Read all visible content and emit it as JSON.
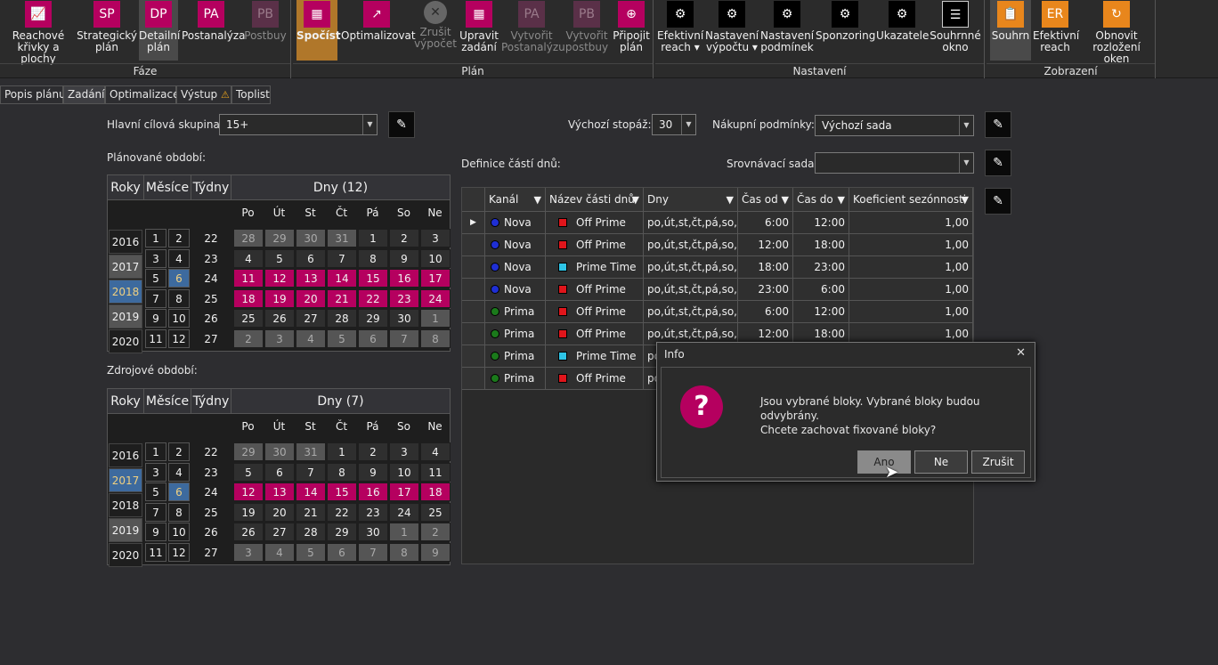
{
  "ribbon": {
    "groups": [
      {
        "label": "Fáze",
        "buttons": [
          {
            "icon": "chart-icon",
            "label": "Reachové\nkřivky a plochy"
          },
          {
            "abbr": "SP",
            "label": "Strategický\nplán"
          },
          {
            "abbr": "DP",
            "label": "Detailní\nplán"
          },
          {
            "abbr": "PA",
            "label": "Postanalýza"
          },
          {
            "abbr": "PB",
            "label": "Postbuy"
          }
        ]
      },
      {
        "label": "Plán",
        "buttons": [
          {
            "icon": "grid-icon",
            "label": "Spočíst"
          },
          {
            "icon": "optimize-icon",
            "label": "Optimalizovat"
          },
          {
            "icon": "cancel-icon",
            "label": "Zrušit\nvýpočet"
          },
          {
            "icon": "grid-edit-icon",
            "label": "Upravit\nzadání"
          },
          {
            "abbr": "PA",
            "label": "Vytvořit\nPostanalýzu"
          },
          {
            "abbr": "PB",
            "label": "Vytvořit\npostbuy"
          },
          {
            "icon": "attach-plan-icon",
            "label": "Připojit\nplán"
          }
        ]
      },
      {
        "label": "Nastavení",
        "buttons": [
          {
            "icon": "gear-icon",
            "label": "Efektivní\nreach ▾"
          },
          {
            "icon": "gear-icon",
            "label": "Nastavení\nvýpočtu ▾"
          },
          {
            "icon": "gear-icon",
            "label": "Nastavení\npodmínek"
          },
          {
            "icon": "gear-icon",
            "label": "Sponzoring"
          },
          {
            "icon": "gear-icon",
            "label": "Ukazatele"
          },
          {
            "icon": "summary-window-icon",
            "label": "Souhrnné\nokno"
          }
        ]
      },
      {
        "label": "Zobrazení",
        "buttons": [
          {
            "icon": "clipboard-icon",
            "label": "Souhrn"
          },
          {
            "abbr": "ER",
            "label": "Efektivní\nreach"
          },
          {
            "icon": "refresh-icon",
            "label": "Obnovit\nrozložení oken"
          }
        ]
      }
    ]
  },
  "tabs": [
    "Popis plánu",
    "Zadání",
    "Optimalizace",
    "Výstup",
    "Toplist"
  ],
  "form": {
    "target_group_label": "Hlavní cílová skupina:",
    "target_group_value": "15+",
    "footage_label": "Výchozí stopáž:",
    "footage_value": "30",
    "purchase_label": "Nákupní podmínky:",
    "purchase_value": "Výchozí sada",
    "planned_period_label": "Plánované období:",
    "daypart_def_label": "Definice částí dnů:",
    "compare_label": "Srovnávací sada:",
    "compare_value": "",
    "source_period_label": "Zdrojové období:"
  },
  "calendar_headers": {
    "years": "Roky",
    "months": "Měsíce",
    "weeks": "Týdny"
  },
  "weekdays": [
    "Po",
    "Út",
    "St",
    "Čt",
    "Pá",
    "So",
    "Ne"
  ],
  "planned": {
    "days_title": "Dny (12)",
    "years": [
      "2016",
      "2017",
      "2018",
      "2019",
      "2020"
    ],
    "months": [
      [
        "1",
        "2"
      ],
      [
        "3",
        "4"
      ],
      [
        "5",
        "6"
      ],
      [
        "7",
        "8"
      ],
      [
        "9",
        "10"
      ],
      [
        "11",
        "12"
      ]
    ],
    "weeks": [
      "22",
      "23",
      "24",
      "25",
      "26",
      "27"
    ],
    "days": [
      [
        "28",
        "29",
        "30",
        "31",
        "1",
        "2",
        "3"
      ],
      [
        "4",
        "5",
        "6",
        "7",
        "8",
        "9",
        "10"
      ],
      [
        "11",
        "12",
        "13",
        "14",
        "15",
        "16",
        "17"
      ],
      [
        "18",
        "19",
        "20",
        "21",
        "22",
        "23",
        "24"
      ],
      [
        "25",
        "26",
        "27",
        "28",
        "29",
        "30",
        "1"
      ],
      [
        "2",
        "3",
        "4",
        "5",
        "6",
        "7",
        "8"
      ]
    ]
  },
  "source": {
    "days_title": "Dny (7)",
    "years": [
      "2016",
      "2017",
      "2018",
      "2019",
      "2020"
    ],
    "months": [
      [
        "1",
        "2"
      ],
      [
        "3",
        "4"
      ],
      [
        "5",
        "6"
      ],
      [
        "7",
        "8"
      ],
      [
        "9",
        "10"
      ],
      [
        "11",
        "12"
      ]
    ],
    "weeks": [
      "22",
      "23",
      "24",
      "25",
      "26",
      "27"
    ],
    "days": [
      [
        "29",
        "30",
        "31",
        "1",
        "2",
        "3",
        "4"
      ],
      [
        "5",
        "6",
        "7",
        "8",
        "9",
        "10",
        "11"
      ],
      [
        "12",
        "13",
        "14",
        "15",
        "16",
        "17",
        "18"
      ],
      [
        "19",
        "20",
        "21",
        "22",
        "23",
        "24",
        "25"
      ],
      [
        "26",
        "27",
        "28",
        "29",
        "30",
        "1",
        "2"
      ],
      [
        "3",
        "4",
        "5",
        "6",
        "7",
        "8",
        "9"
      ]
    ]
  },
  "dayparts": {
    "columns": [
      "Kanál",
      "Název části dnů",
      "Dny",
      "Čas od",
      "Čas do",
      "Koeficient sezónnosti"
    ],
    "rows": [
      {
        "channel": "Nova",
        "name": "Off Prime",
        "days": "po,út,st,čt,pá,so,ne",
        "from": "6:00",
        "to": "12:00",
        "coef": "1,00"
      },
      {
        "channel": "Nova",
        "name": "Off Prime",
        "days": "po,út,st,čt,pá,so,ne",
        "from": "12:00",
        "to": "18:00",
        "coef": "1,00"
      },
      {
        "channel": "Nova",
        "name": "Prime Time",
        "days": "po,út,st,čt,pá,so,ne",
        "from": "18:00",
        "to": "23:00",
        "coef": "1,00"
      },
      {
        "channel": "Nova",
        "name": "Off Prime",
        "days": "po,út,st,čt,pá,so,ne",
        "from": "23:00",
        "to": "6:00",
        "coef": "1,00"
      },
      {
        "channel": "Prima",
        "name": "Off Prime",
        "days": "po,út,st,čt,pá,so,ne",
        "from": "6:00",
        "to": "12:00",
        "coef": "1,00"
      },
      {
        "channel": "Prima",
        "name": "Off Prime",
        "days": "po,út,st,čt,pá,so,ne",
        "from": "12:00",
        "to": "18:00",
        "coef": "1,00"
      },
      {
        "channel": "Prima",
        "name": "Prime Time",
        "days": "po",
        "from": "",
        "to": "",
        "coef": ""
      },
      {
        "channel": "Prima",
        "name": "Off Prime",
        "days": "po",
        "from": "",
        "to": "",
        "coef": ""
      }
    ]
  },
  "dialog": {
    "title": "Info",
    "message_line1": "Jsou vybrané bloky. Vybrané bloky budou odvybrány.",
    "message_line2": "Chcete zachovat fixované bloky?",
    "yes": "Ano",
    "no": "Ne",
    "cancel": "Zrušit"
  },
  "colors": {
    "magenta": "#b5005f",
    "selected_blue": "#3d6a9e",
    "nova_dot": "#1f2fd4",
    "prima_dot": "#1b7a1b",
    "off_prime": "#e0151b",
    "prime_time": "#2ec4e6",
    "accent_orange": "#e8861c"
  }
}
